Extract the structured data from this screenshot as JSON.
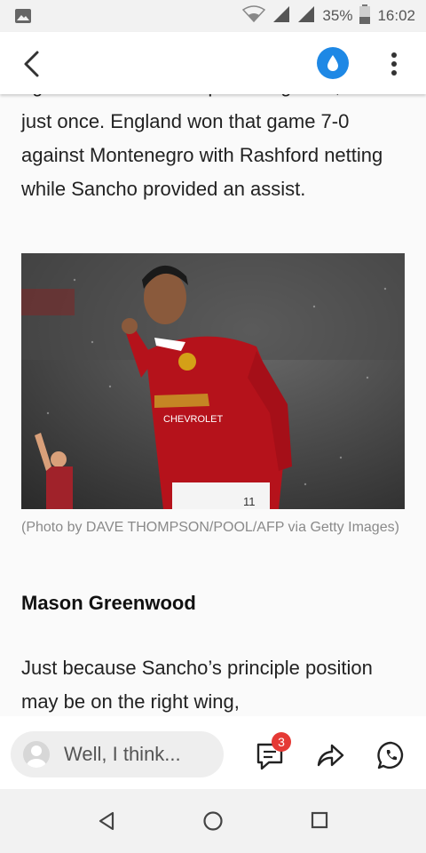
{
  "status_bar": {
    "battery": "35%",
    "time": "16:02"
  },
  "article": {
    "partial_line": "against the Czech Republic together,",
    "para_top": "just once. England won that game 7-0 against Montenegro with Rashford netting while Sancho provided an assist.",
    "photo_caption": "(Photo by DAVE THOMPSON/POOL/AFP via Getty Images)",
    "photo_sponsor_text": "CHEVROLET",
    "photo_shirt_number": "11",
    "subheading": "Mason Greenwood",
    "para_bottom": "Just because Sancho’s principle position may be on the right wing,"
  },
  "bottom_bar": {
    "comment_placeholder": "Well, I think...",
    "comments_count": "3"
  },
  "colors": {
    "accent": "#1e88e5",
    "badge": "#e53935"
  }
}
